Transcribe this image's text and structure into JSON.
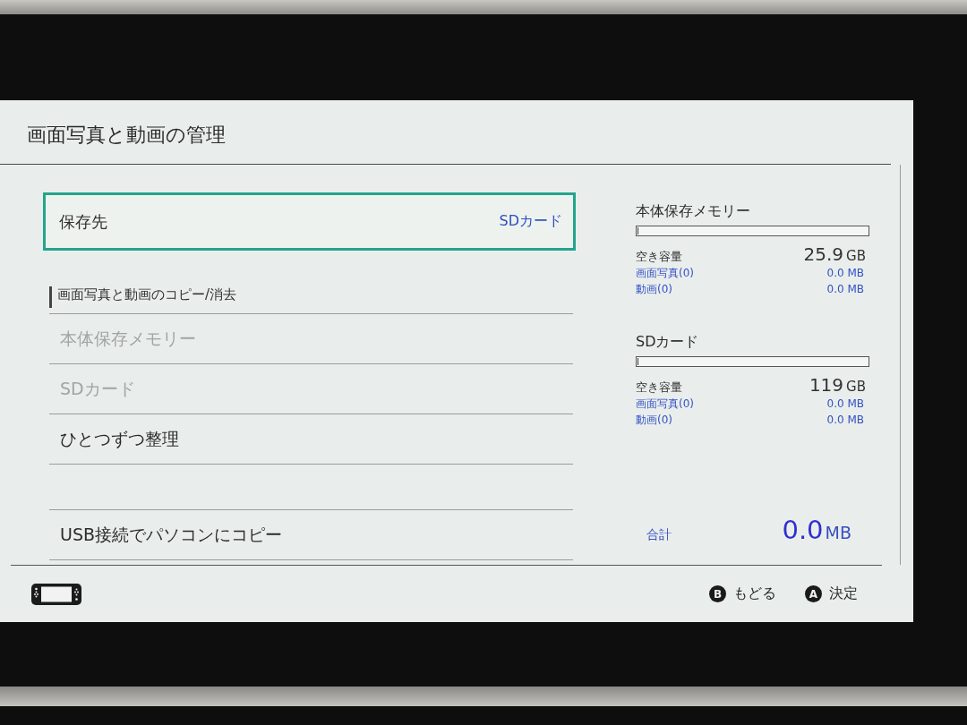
{
  "screen": {
    "title": "画面写真と動画の管理",
    "save_location": {
      "label": "保存先",
      "value": "SDカード",
      "selected": true
    },
    "copy_section": {
      "heading": "画面写真と動画のコピー/消去",
      "groups": [
        [
          {
            "label": "本体保存メモリー",
            "disabled": true
          },
          {
            "label": "SDカード",
            "disabled": true
          },
          {
            "label": "ひとつずつ整理",
            "disabled": false
          }
        ],
        [
          {
            "label": "USB接続でパソコンにコピー",
            "disabled": false
          }
        ]
      ]
    },
    "storages": [
      {
        "name": "本体保存メモリー",
        "level": 0.005,
        "free_label": "空き容量",
        "free_value": "25.9",
        "free_unit": "GB",
        "rows": [
          {
            "label": "画面写真(0)",
            "value": "0.0 MB"
          },
          {
            "label": "動画(0)",
            "value": "0.0 MB"
          }
        ]
      },
      {
        "name": "SDカード",
        "level": 0.005,
        "free_label": "空き容量",
        "free_value": "119",
        "free_unit": "GB",
        "rows": [
          {
            "label": "画面写真(0)",
            "value": "0.0 MB"
          },
          {
            "label": "動画(0)",
            "value": "0.0 MB"
          }
        ]
      }
    ],
    "total": {
      "label": "合計",
      "value": "0.0",
      "unit": "MB"
    },
    "footer": {
      "hints": [
        {
          "glyph": "B",
          "label": "もどる"
        },
        {
          "glyph": "A",
          "label": "決定"
        }
      ]
    }
  }
}
